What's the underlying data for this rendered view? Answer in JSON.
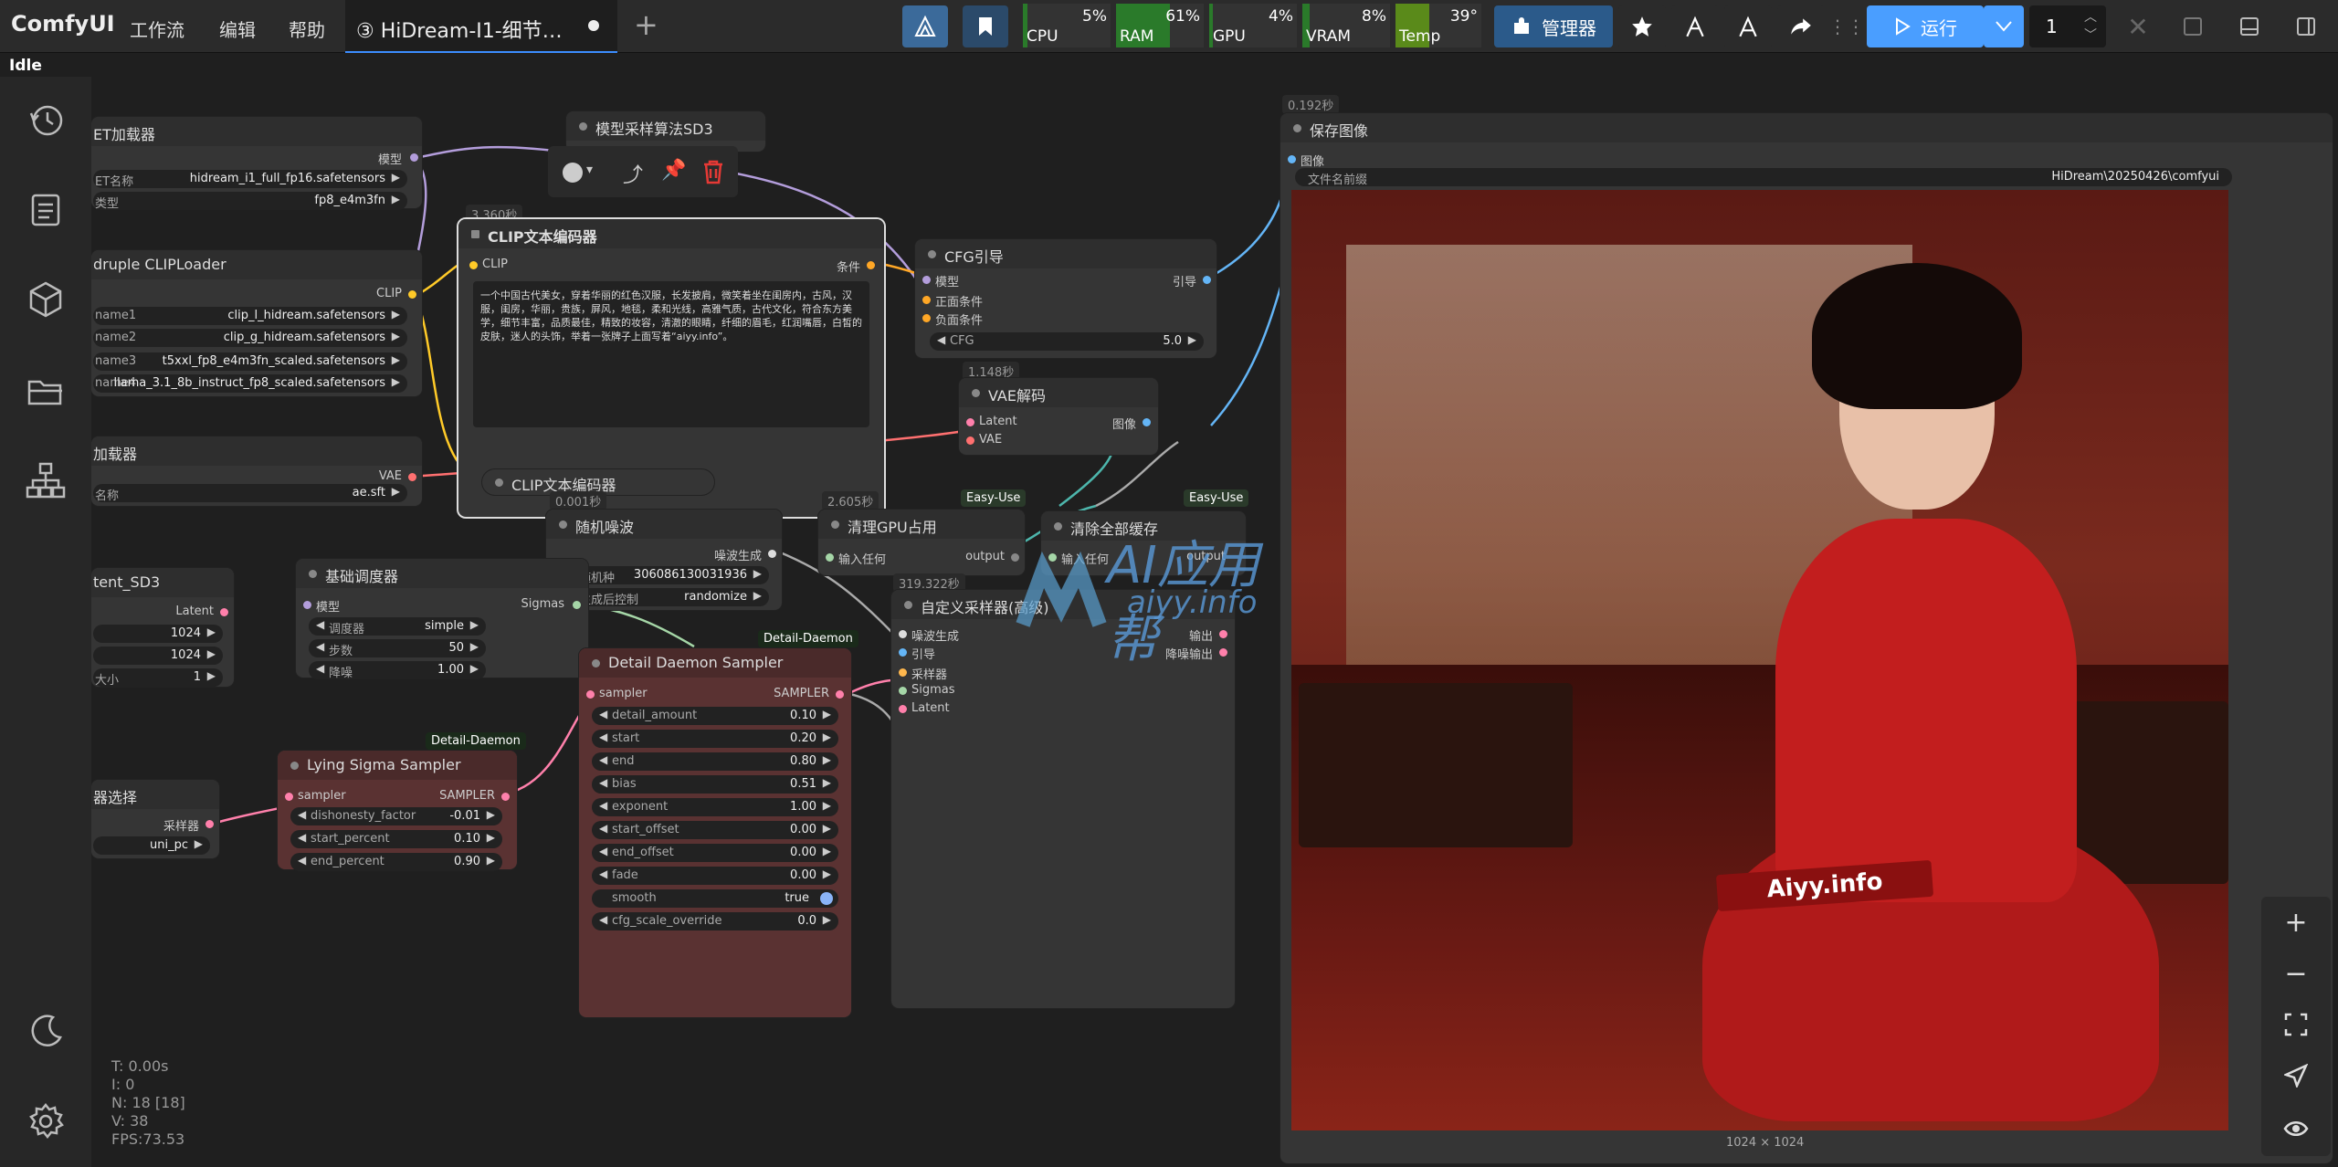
{
  "app": {
    "name": "ComfyUI",
    "status": "Idle"
  },
  "menu": [
    "工作流",
    "编辑",
    "帮助"
  ],
  "tab": {
    "title": "③ HiDream-I1-细节…"
  },
  "meters": [
    {
      "label": "CPU",
      "value": "5%",
      "level": 0.05
    },
    {
      "label": "RAM",
      "value": "61%",
      "level": 0.61
    },
    {
      "label": "GPU",
      "value": "4%",
      "level": 0.04
    },
    {
      "label": "VRAM",
      "value": "8%",
      "level": 0.08
    },
    {
      "label": "Temp",
      "value": "39°",
      "level": 0.39
    }
  ],
  "toolbar": {
    "manager_label": "管理器",
    "run_label": "运行",
    "queue_count": "1"
  },
  "sidebar": {
    "items": [
      "history-icon",
      "queue-icon",
      "model-library-icon",
      "workflow-folder-icon",
      "node-library-icon",
      "theme-toggle-icon",
      "settings-icon"
    ]
  },
  "nodes": {
    "unet": {
      "title": "ET加载器",
      "out": "模型",
      "w1_label": "ET名称",
      "w1_value": "hidream_i1_full_fp16.safetensors",
      "w2_label": "类型",
      "w2_value": "fp8_e4m3fn"
    },
    "clip_loader": {
      "title": "druple CLIPLoader",
      "out": "CLIP",
      "rows": [
        {
          "label": "name1",
          "value": "clip_l_hidream.safetensors"
        },
        {
          "label": "name2",
          "value": "clip_g_hidream.safetensors"
        },
        {
          "label": "name3",
          "value": "t5xxl_fp8_e4m3fn_scaled.safetensors"
        },
        {
          "label": "name4",
          "value": "llama_3.1_8b_instruct_fp8_scaled.safetensors"
        }
      ]
    },
    "vae_loader": {
      "title": "加载器",
      "out": "VAE",
      "w_label": "名称",
      "w_value": "ae.sft"
    },
    "latent": {
      "title": "tent_SD3",
      "out": "Latent",
      "rows": [
        "1024",
        "1024",
        "1"
      ],
      "last_label": "大小"
    },
    "sampler_algo": {
      "title": "模型采样算法SD3"
    },
    "clip_text": {
      "title": "CLIP文本编码器",
      "timing": "3.360秒",
      "in": "CLIP",
      "out": "条件",
      "text": "一个中国古代美女，穿着华丽的红色汉服，长发披肩，微笑着坐在闺房内，古风，汉服，闺房，华丽，贵族，屏风，地毯，柔和光线，高雅气质，古代文化，符合东方美学，细节丰富，品质最佳，精致的妆容，清澈的眼睛，纤细的眉毛，红润嘴唇，白皙的皮肤，迷人的头饰，举着一张牌子上面写着“aiyy.info”。"
    },
    "clip_text2": {
      "title": "CLIP文本编码器"
    },
    "cfg": {
      "title": "CFG引导",
      "out": "引导",
      "in1": "模型",
      "in2": "正面条件",
      "in3": "负面条件",
      "w_label": "CFG",
      "w_value": "5.0"
    },
    "vae_decode": {
      "title": "VAE解码",
      "timing": "1.148秒",
      "in1": "Latent",
      "in2": "VAE",
      "out": "图像"
    },
    "save": {
      "title": "保存图像",
      "timing": "0.192秒",
      "in": "图像",
      "w_label": "文件名前缀",
      "w_value": "HiDream\\20250426\\comfyui",
      "dims": "1024 × 1024"
    },
    "noise": {
      "title": "随机噪波",
      "timing": "0.001秒",
      "out": "噪波生成",
      "seed_label": "随机种",
      "seed_value": "306086130031936",
      "ctrl_label": "生成后控制",
      "ctrl_value": "randomize"
    },
    "scheduler": {
      "title": "基础调度器",
      "in": "模型",
      "out": "Sigmas",
      "rows": [
        {
          "label": "调度器",
          "value": "simple"
        },
        {
          "label": "步数",
          "value": "50"
        },
        {
          "label": "降噪",
          "value": "1.00"
        }
      ]
    },
    "clear_gpu": {
      "title": "清理GPU占用",
      "timing": "2.605秒",
      "badge": "Easy-Use",
      "in": "输入任何",
      "out": "output"
    },
    "clear_cache": {
      "title": "清除全部缓存",
      "badge": "Easy-Use",
      "in": "输入任何",
      "out": "output"
    },
    "custom_sampler": {
      "title": "自定义采样器(高级)",
      "timing": "319.322秒",
      "inputs": [
        "噪波生成",
        "引导",
        "采样器",
        "Sigmas",
        "Latent"
      ],
      "out1": "输出",
      "out2": "降噪输出"
    },
    "detail_daemon": {
      "title": "Detail Daemon Sampler",
      "badge": "Detail-Daemon",
      "in": "sampler",
      "out": "SAMPLER",
      "rows": [
        {
          "label": "detail_amount",
          "value": "0.10"
        },
        {
          "label": "start",
          "value": "0.20"
        },
        {
          "label": "end",
          "value": "0.80"
        },
        {
          "label": "bias",
          "value": "0.51"
        },
        {
          "label": "exponent",
          "value": "1.00"
        },
        {
          "label": "start_offset",
          "value": "0.00"
        },
        {
          "label": "end_offset",
          "value": "0.00"
        },
        {
          "label": "fade",
          "value": "0.00"
        },
        {
          "label": "smooth",
          "value": "true"
        },
        {
          "label": "cfg_scale_override",
          "value": "0.0"
        }
      ]
    },
    "lying": {
      "title": "Lying Sigma Sampler",
      "badge": "Detail-Daemon",
      "in": "sampler",
      "out": "SAMPLER",
      "rows": [
        {
          "label": "dishonesty_factor",
          "value": "-0.01"
        },
        {
          "label": "start_percent",
          "value": "0.10"
        },
        {
          "label": "end_percent",
          "value": "0.90"
        }
      ]
    },
    "ksel": {
      "title": "器选择",
      "out": "采样器",
      "w_value": "uni_pc"
    }
  },
  "watermark": {
    "line1": "AI应用帮",
    "line2": "aiyy.info"
  },
  "image_sign": "Aiyy.info",
  "stats": {
    "t": "T: 0.00s",
    "i": "I: 0",
    "n": "N: 18 [18]",
    "v": "V: 38",
    "fps": "FPS:73.53"
  }
}
